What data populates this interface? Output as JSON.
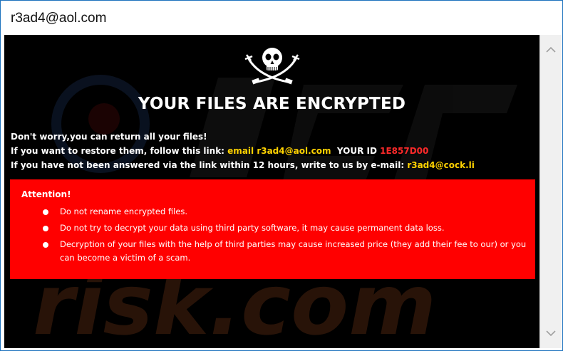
{
  "window": {
    "title": "r3ad4@aol.com"
  },
  "note": {
    "headline": "YOUR FILES ARE ENCRYPTED",
    "line1": "Don't worry,you can return all your files!",
    "line2_prefix": "If you want to restore them, follow this link: ",
    "line2_email_label": "email r3ad4@aol.com",
    "line2_id_label": "  YOUR ID ",
    "line2_id_value": "1E857D00",
    "line3_prefix": "If you have not been answered via the link within 12 hours, write to us by e-mail: ",
    "line3_email": "r3ad4@cock.li"
  },
  "attention": {
    "title": "Attention!",
    "items": [
      "Do not rename encrypted files.",
      "Do not try to decrypt your data using third party software, it may cause permanent data loss.",
      "Decryption of your files with the help of third parties may cause increased price (they add their fee to our) or you can become a victim of a scam."
    ]
  },
  "icons": {
    "logo": "skull-crossbones-icon",
    "scroll_up": "chevron-up-icon",
    "scroll_down": "chevron-down-icon"
  },
  "watermark": {
    "text": "risk.com"
  },
  "colors": {
    "background": "#000000",
    "attention_box": "#ff0000",
    "highlight_yellow": "#ffd200",
    "highlight_red": "#ff2a2a",
    "window_border": "#1e73be"
  }
}
